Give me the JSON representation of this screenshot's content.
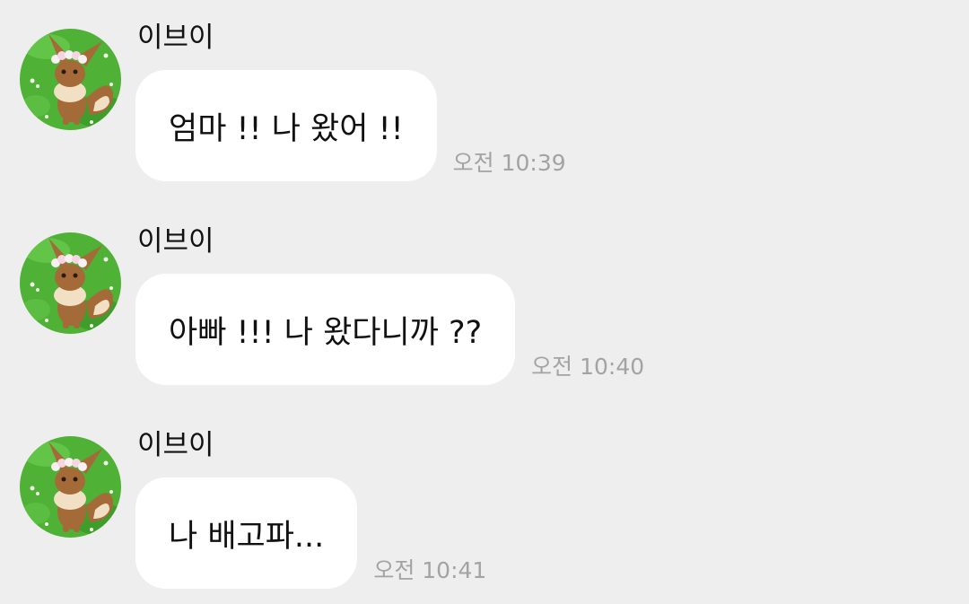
{
  "messages": [
    {
      "sender": "이브이",
      "text": "엄마 !! 나 왔어 !!",
      "time": "오전 10:39"
    },
    {
      "sender": "이브이",
      "text": "아빠 !!! 나 왔다니까 ??",
      "time": "오전 10:40"
    },
    {
      "sender": "이브이",
      "text": "나 배고파...",
      "time": "오전 10:41"
    }
  ],
  "colors": {
    "background": "#eeeeee",
    "bubble": "#ffffff",
    "time_text": "#a3a3a3",
    "avatar_grass": "#4fb135"
  },
  "icons": {
    "avatar": "eevee-profile-picture"
  }
}
